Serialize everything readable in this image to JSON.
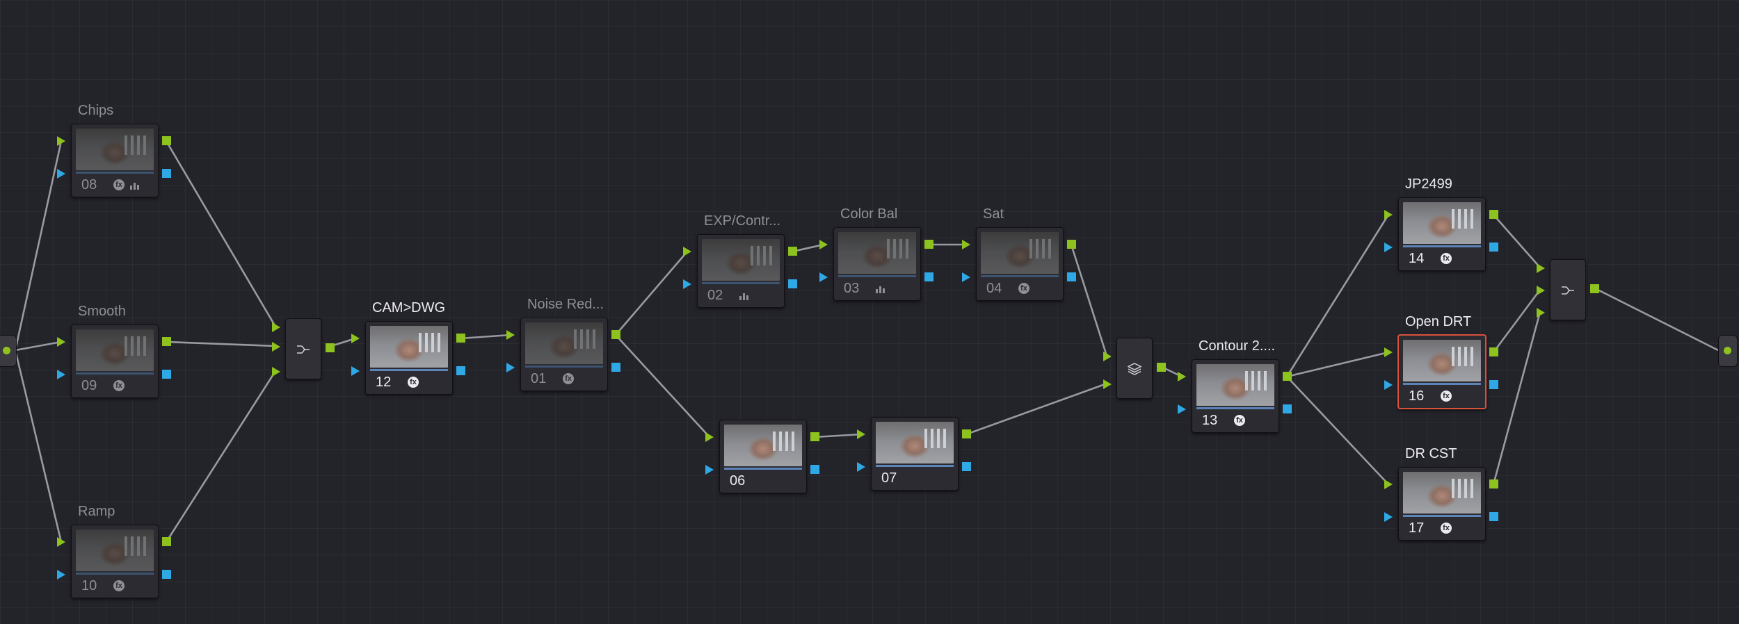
{
  "app": "DaVinci Resolve Color Page Node Graph",
  "colors": {
    "background": "#23232a",
    "rgb_port": "#8dc21f",
    "key_port": "#2fa8e6",
    "selected_border": "#d8523c",
    "wire": "#9a9aa2"
  },
  "nodes": {
    "chips": {
      "label": "Chips",
      "number": "08",
      "fx": "fx",
      "icon": "bars-icon"
    },
    "smooth": {
      "label": "Smooth",
      "number": "09",
      "fx": "fx"
    },
    "ramp": {
      "label": "Ramp",
      "number": "10",
      "fx": "fx"
    },
    "cam_dwg": {
      "label": "CAM>DWG",
      "number": "12",
      "fx": "fx"
    },
    "noise_red": {
      "label": "Noise Red...",
      "number": "01",
      "fx": "fx"
    },
    "exp_contr": {
      "label": "EXP/Contr...",
      "number": "02",
      "icon": "bars-icon"
    },
    "color_bal": {
      "label": "Color Bal",
      "number": "03",
      "icon": "bars-icon"
    },
    "sat": {
      "label": "Sat",
      "number": "04",
      "fx": "fx"
    },
    "n06": {
      "label": "",
      "number": "06"
    },
    "n07": {
      "label": "",
      "number": "07"
    },
    "contour": {
      "label": "Contour 2....",
      "number": "13",
      "fx": "fx"
    },
    "jp2499": {
      "label": "JP2499",
      "number": "14",
      "fx": "fx"
    },
    "open_drt": {
      "label": "Open DRT",
      "number": "16",
      "fx": "fx",
      "selected": true
    },
    "dr_cst": {
      "label": "DR CST",
      "number": "17",
      "fx": "fx"
    }
  },
  "mixers": {
    "parallel_mixer_1": {
      "icon": "parallel-mixer-icon"
    },
    "layer_mixer": {
      "icon": "layer-mixer-icon"
    },
    "parallel_mixer_2": {
      "icon": "parallel-mixer-icon"
    }
  }
}
